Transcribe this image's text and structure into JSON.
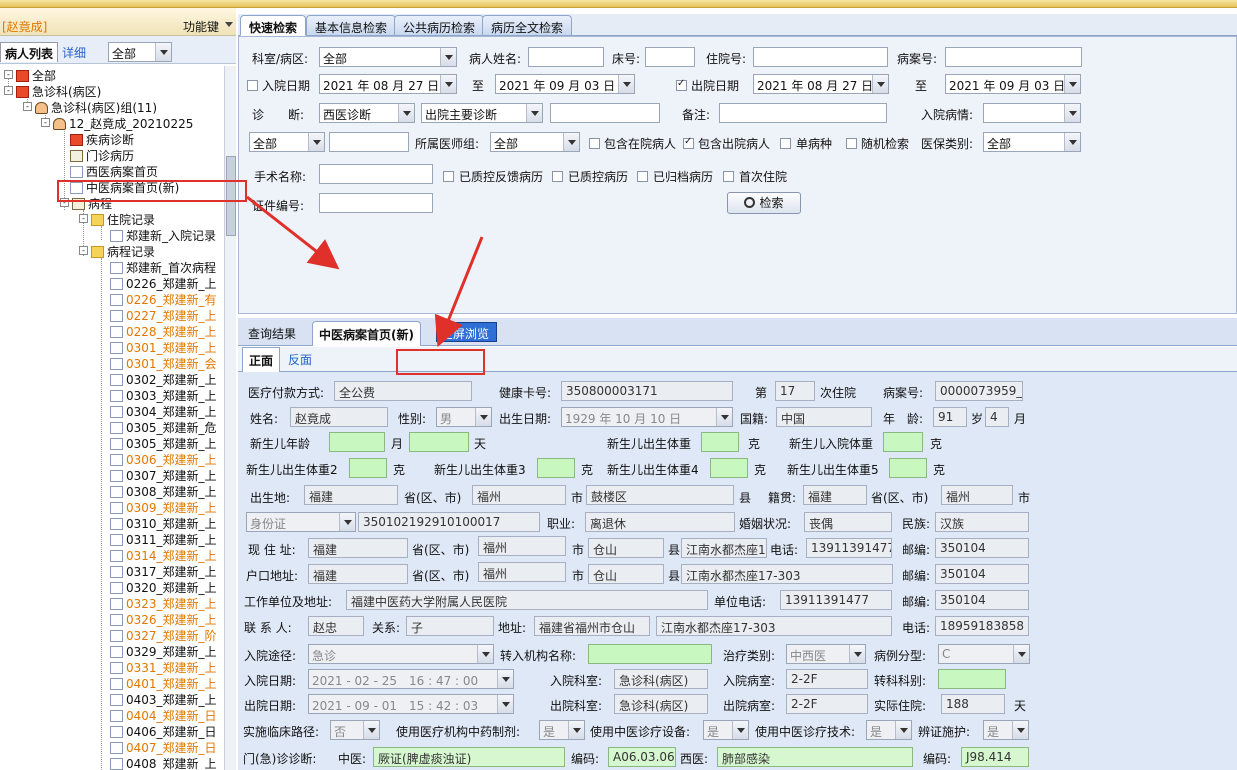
{
  "left": {
    "user": "[赵竟成]",
    "func_label": "功能键",
    "tab_list": "病人列表",
    "tab_detail": "详细",
    "filter": "全部",
    "tree": [
      {
        "label": "全部"
      },
      {
        "label": "急诊科(病区)"
      },
      {
        "label": "急诊科(病区)组(11)"
      },
      {
        "label": "12_赵竟成_20210225"
      },
      {
        "label": "疾病诊断"
      },
      {
        "label": "门诊病历"
      },
      {
        "label": "西医病案首页"
      },
      {
        "label": "中医病案首页(新)"
      },
      {
        "label": "病程"
      },
      {
        "label": "住院记录"
      },
      {
        "label": "郑建新_入院记录"
      },
      {
        "label": "病程记录"
      },
      {
        "label": "郑建新_首次病程"
      },
      {
        "label": "0226_郑建新_上"
      },
      {
        "label": "0226_郑建新_有"
      },
      {
        "label": "0227_郑建新_上"
      },
      {
        "label": "0228_郑建新_上"
      },
      {
        "label": "0301_郑建新_上"
      },
      {
        "label": "0301_郑建新_会"
      },
      {
        "label": "0302_郑建新_上"
      },
      {
        "label": "0303_郑建新_上"
      },
      {
        "label": "0304_郑建新_上"
      },
      {
        "label": "0305_郑建新_危"
      },
      {
        "label": "0305_郑建新_上"
      },
      {
        "label": "0306_郑建新_上"
      },
      {
        "label": "0307_郑建新_上"
      },
      {
        "label": "0308_郑建新_上"
      },
      {
        "label": "0309_郑建新_上"
      },
      {
        "label": "0310_郑建新_上"
      },
      {
        "label": "0311_郑建新_上"
      },
      {
        "label": "0314_郑建新_上"
      },
      {
        "label": "0317_郑建新_上"
      },
      {
        "label": "0320_郑建新_上"
      },
      {
        "label": "0323_郑建新_上"
      },
      {
        "label": "0326_郑建新_上"
      },
      {
        "label": "0327_郑建新_阶"
      },
      {
        "label": "0329_郑建新_上"
      },
      {
        "label": "0331_郑建新_上"
      },
      {
        "label": "0401_郑建新_上"
      },
      {
        "label": "0403_郑建新_上"
      },
      {
        "label": "0404_郑建新_日"
      },
      {
        "label": "0406_郑建新_日"
      },
      {
        "label": "0407_郑建新_日"
      },
      {
        "label": "0408_郑建新_上"
      }
    ]
  },
  "tabs": [
    "快速检索",
    "基本信息检索",
    "公共病历检索",
    "病历全文检索"
  ],
  "search": {
    "dept_label": "科室/病区:",
    "dept": "全部",
    "name_label": "病人姓名:",
    "bed_label": "床号:",
    "inno_label": "住院号:",
    "caseno_label": "病案号:",
    "in_date_label": "入院日期",
    "in_from": "2021 年 08 月 27 日",
    "to1": "至",
    "in_to": "2021 年 09 月 03 日",
    "out_date_label": "出院日期",
    "out_from": "2021 年 08 月 27 日",
    "to2": "至",
    "out_to": "2021 年 09 月 03 日",
    "diag_label": "诊　　断:",
    "diag_type": "西医诊断",
    "diag_sub": "出院主要诊断",
    "note_label": "备注:",
    "cond_label": "入院病情:",
    "all1": "全部",
    "group_label": "所属医师组:",
    "group": "全部",
    "cb_in": "包含在院病人",
    "cb_out": "包含出院病人",
    "cb_single": "单病种",
    "cb_random": "随机检索",
    "ins_label": "医保类别:",
    "ins": "全部",
    "op_label": "手术名称:",
    "cb_qc_fb": "已质控反馈病历",
    "cb_qc": "已质控病历",
    "cb_arch": "已归档病历",
    "cb_first": "首次住院",
    "id_label": "证件编号:",
    "search_btn": "检索"
  },
  "bottom_tabs": {
    "result": "查询结果",
    "form": "中医病案首页(新)",
    "fullscreen": "全屏浏览",
    "front": "正面",
    "back": "反面"
  },
  "form": {
    "pay_label": "医疗付款方式:",
    "pay": "全公费",
    "card_label": "健康卡号:",
    "card": "350800003171",
    "nth_label": "第",
    "nth": "17",
    "nth_suffix": "次住院",
    "caseno_label": "病案号:",
    "caseno": "0000073959_0",
    "name_label": "姓名:",
    "name": "赵竟成",
    "sex_label": "性别:",
    "sex": "男",
    "birth_label": "出生日期:",
    "birth": "1929 年 10 月 10 日",
    "nation_label": "国籍:",
    "nation": "中国",
    "age_label": "年　龄:",
    "age": "91",
    "age_unit": "岁",
    "months": "4",
    "month_unit": "月",
    "nb_age": "新生儿年龄",
    "month": "月",
    "day": "天",
    "nb_bw": "新生儿出生体重",
    "g": "克",
    "nb_inw": "新生儿入院体重",
    "nb_bw2": "新生儿出生体重2",
    "nb_bw3": "新生儿出生体重3",
    "nb_bw4": "新生儿出生体重4",
    "nb_bw5": "新生儿出生体重5",
    "bp_label": "出生地:",
    "bp_prov": "福建",
    "prov": "省(区、市)",
    "bp_city": "福州",
    "city": "市",
    "bp_county": "鼓楼区",
    "county": "县",
    "origin_label": "籍贯:",
    "origin_prov": "福建",
    "origin_city": "福州",
    "id_type": "身份证",
    "id_no": "350102192910100017",
    "job_label": "职业:",
    "job": "离退休",
    "marital_label": "婚姻状况:",
    "marital": "丧偶",
    "ethnic_label": "民族:",
    "ethnic": "汉族",
    "addr_label": "现 住 址:",
    "addr_prov": "福建",
    "addr_city": "福州",
    "addr_county": "仓山",
    "addr_detail": "江南水都杰座1",
    "phone_label": "电话:",
    "phone": "13911391477",
    "zip_label": "邮编:",
    "zip": "350104",
    "hukou_label": "户口地址:",
    "hukou_prov": "福建",
    "hukou_city": "福州",
    "hukou_county": "仓山",
    "hukou_detail": "江南水都杰座17-303",
    "hukou_zip": "350104",
    "work_label": "工作单位及地址:",
    "work": "福建中医药大学附属人民医院",
    "work_phone_label": "单位电话:",
    "work_phone": "13911391477",
    "work_zip": "350104",
    "contact_label": "联 系 人:",
    "contact": "赵忠",
    "rel_label": "关系:",
    "rel": "子",
    "caddr_label": "地址:",
    "caddr": "福建省福州市仓山",
    "caddr2": "江南水都杰座17-303",
    "cphone": "18959183858",
    "route_label": "入院途径:",
    "route": "急诊",
    "transfer_label": "转入机构名称:",
    "treat_label": "治疗类别:",
    "treat": "中西医",
    "case_type_label": "病例分型:",
    "case_type": "C",
    "in_date_label": "入院日期:",
    "in_date": "2021 - 02 - 25　16 : 47 : 00",
    "in_dept_label": "入院科室:",
    "in_dept": "急诊科(病区)",
    "in_ward_label": "入院病室:",
    "in_ward": "2-2F",
    "trans_label": "转科科别:",
    "out_date_label": "出院日期:",
    "out_date": "2021 - 09 - 01　15 : 42 : 03",
    "out_dept_label": "出院科室:",
    "out_dept": "急诊科(病区)",
    "out_ward_label": "出院病室:",
    "out_ward": "2-2F",
    "days_label": "实际住院:",
    "days": "188",
    "days_unit": "天",
    "path_label": "实施临床路径:",
    "path": "否",
    "herb_label": "使用医疗机构中药制剂:",
    "herb": "是",
    "equip_label": "使用中医诊疗设备:",
    "equip": "是",
    "tech_label": "使用中医诊疗技术:",
    "tech": "是",
    "nurse_label": "辨证施护:",
    "nurse": "是",
    "ed_label": "门(急)诊诊断:",
    "tcm_label": "中医:",
    "tcm": "厥证(脾虚痰浊证)",
    "code_label": "编码:",
    "tcm_code": "A06.03.06",
    "wm_label": "西医:",
    "wm": "肺部感染",
    "wm_code": "J98.414"
  }
}
